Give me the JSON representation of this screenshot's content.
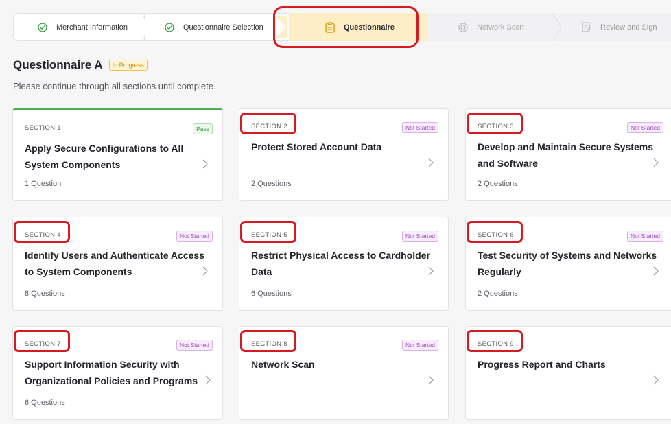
{
  "stepper": {
    "steps": [
      {
        "label": "Merchant Information",
        "state": "complete",
        "icon": "check-circle-icon"
      },
      {
        "label": "Questionnaire Selection",
        "state": "complete",
        "icon": "check-circle-icon"
      },
      {
        "label": "Questionnaire",
        "state": "current",
        "icon": "clipboard-icon"
      },
      {
        "label": "Network Scan",
        "state": "upcoming",
        "icon": "scan-icon"
      },
      {
        "label": "Review and Sign",
        "state": "upcoming",
        "icon": "sign-document-icon"
      }
    ]
  },
  "header": {
    "title": "Questionnaire A",
    "status": "In Progress",
    "subtitle": "Please continue through all sections until complete."
  },
  "sections": [
    {
      "label": "SECTION 1",
      "title": "Apply Secure Configurations to All System Components",
      "status": "Pass",
      "count": "1 Question"
    },
    {
      "label": "SECTION 2",
      "title": "Protect Stored Account Data",
      "status": "Not Started",
      "count": "2 Questions"
    },
    {
      "label": "SECTION 3",
      "title": "Develop and Maintain Secure Systems and Software",
      "status": "Not Started",
      "count": "2 Questions"
    },
    {
      "label": "SECTION 4",
      "title": "Identify Users and Authenticate Access to System Components",
      "status": "Not Started",
      "count": "8 Questions"
    },
    {
      "label": "SECTION 5",
      "title": "Restrict Physical Access to Cardholder Data",
      "status": "Not Started",
      "count": "6 Questions"
    },
    {
      "label": "SECTION 6",
      "title": "Test Security of Systems and Networks Regularly",
      "status": "Not Started",
      "count": "2 Questions"
    },
    {
      "label": "SECTION 7",
      "title": "Support Information Security with Organizational Policies and Programs",
      "status": "Not Started",
      "count": "6 Questions"
    },
    {
      "label": "SECTION 8",
      "title": "Network Scan",
      "status": "Not Started",
      "count": ""
    },
    {
      "label": "SECTION 9",
      "title": "Progress Report and Charts",
      "status": "",
      "count": ""
    }
  ],
  "colors": {
    "accent_current_step": "#fdeec6",
    "pass_green": "#4cae4f",
    "not_started_purple": "#a44bc4",
    "annotation_red": "#d71920"
  }
}
